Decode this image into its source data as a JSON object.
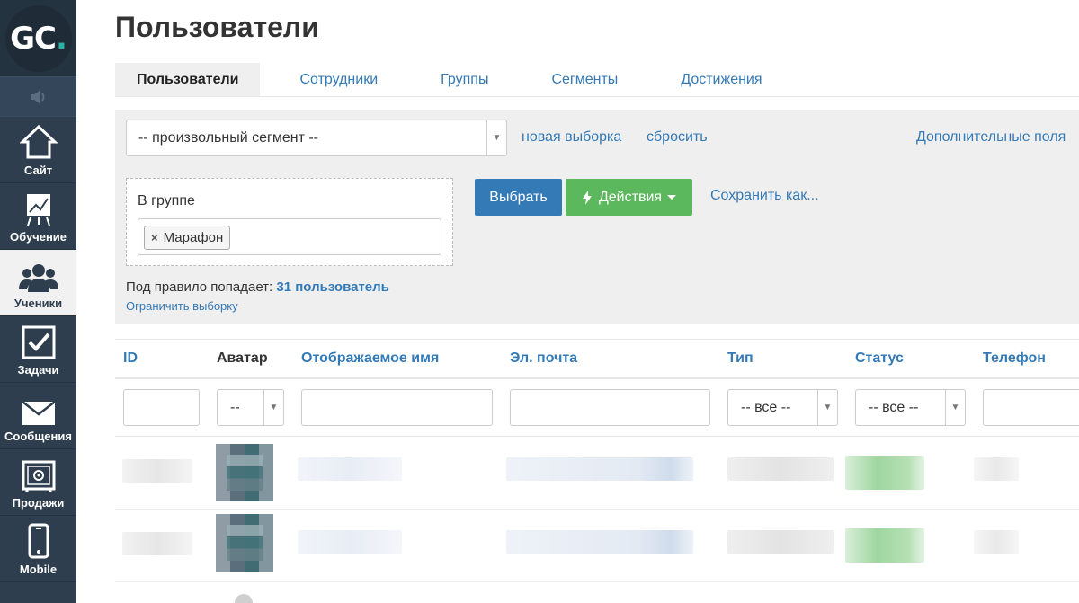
{
  "logo": {
    "text": "GC",
    "dot": "."
  },
  "nav": [
    {
      "label": "Сайт",
      "icon": "home-icon"
    },
    {
      "label": "Обучение",
      "icon": "chart-board-icon"
    },
    {
      "label": "Ученики",
      "icon": "users-icon"
    },
    {
      "label": "Задачи",
      "icon": "checkbox-icon"
    },
    {
      "label": "Сообщения",
      "icon": "envelope-icon"
    },
    {
      "label": "Продажи",
      "icon": "safe-icon"
    },
    {
      "label": "Mobile",
      "icon": "mobile-phone-icon"
    }
  ],
  "page": {
    "title": "Пользователи"
  },
  "tabs": [
    "Пользователи",
    "Сотрудники",
    "Группы",
    "Сегменты",
    "Достижения"
  ],
  "filters": {
    "segment_select": "-- произвольный сегмент --",
    "new_selection": "новая выборка",
    "reset": "сбросить",
    "extra_fields": "Дополнительные поля",
    "rule_label": "В группе",
    "chip": "Марафон",
    "chip_remove": "×",
    "select_button": "Выбрать",
    "actions_button": "Действия",
    "save_as": "Сохранить как...",
    "count_prefix": "Под правило попадает:",
    "count_value": "31 пользователь",
    "limit_link": "Ограничить выборку"
  },
  "table": {
    "columns": [
      "ID",
      "Аватар",
      "Отображаемое имя",
      "Эл. почта",
      "Тип",
      "Статус",
      "Телефон"
    ],
    "avatar_filter": "--",
    "type_filter": "-- все --",
    "status_filter": "-- все --"
  },
  "colors": {
    "sidebar": "#2e3e4e",
    "primary": "#337ab7",
    "success": "#5cb85c",
    "accent": "#27b3a3"
  }
}
